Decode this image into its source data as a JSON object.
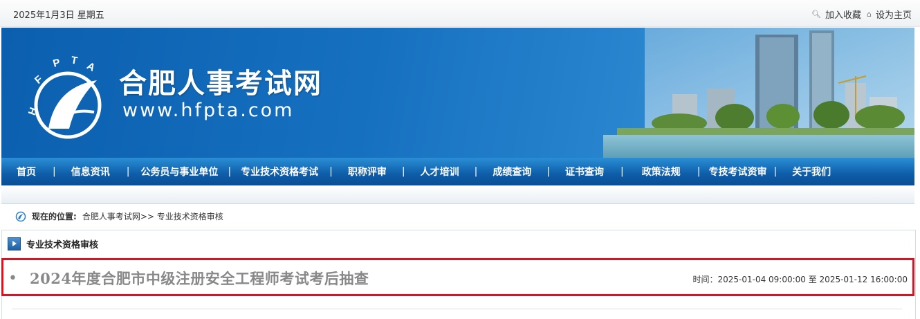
{
  "topbar": {
    "date": "2025年1月3日 星期五",
    "bookmark_label": "加入收藏",
    "homepage_label": "设为主页"
  },
  "banner": {
    "site_title": "合肥人事考试网",
    "site_url": "www.hfpta.com",
    "logo_text": "HFPTA"
  },
  "nav": {
    "items": [
      "首页",
      "信息资讯",
      "公务员与事业单位",
      "专业技术资格考试",
      "职称评审",
      "人才培训",
      "成绩查询",
      "证书查询",
      "政策法规",
      "专技考试资审",
      "关于我们"
    ]
  },
  "breadcrumb": {
    "label": "现在的位置",
    "path": "合肥人事考试网>> 专业技术资格审核"
  },
  "section": {
    "title": "专业技术资格审核"
  },
  "article": {
    "title": "2024年度合肥市中级注册安全工程师考试考后抽查",
    "time_label": "时间：",
    "time_range": "2025-01-04 09:00:00 至 2025-01-12 16:00:00"
  },
  "colors": {
    "brand_blue": "#0b5fae",
    "nav_blue": "#0e5ca8",
    "highlight_red": "#e0101e"
  }
}
